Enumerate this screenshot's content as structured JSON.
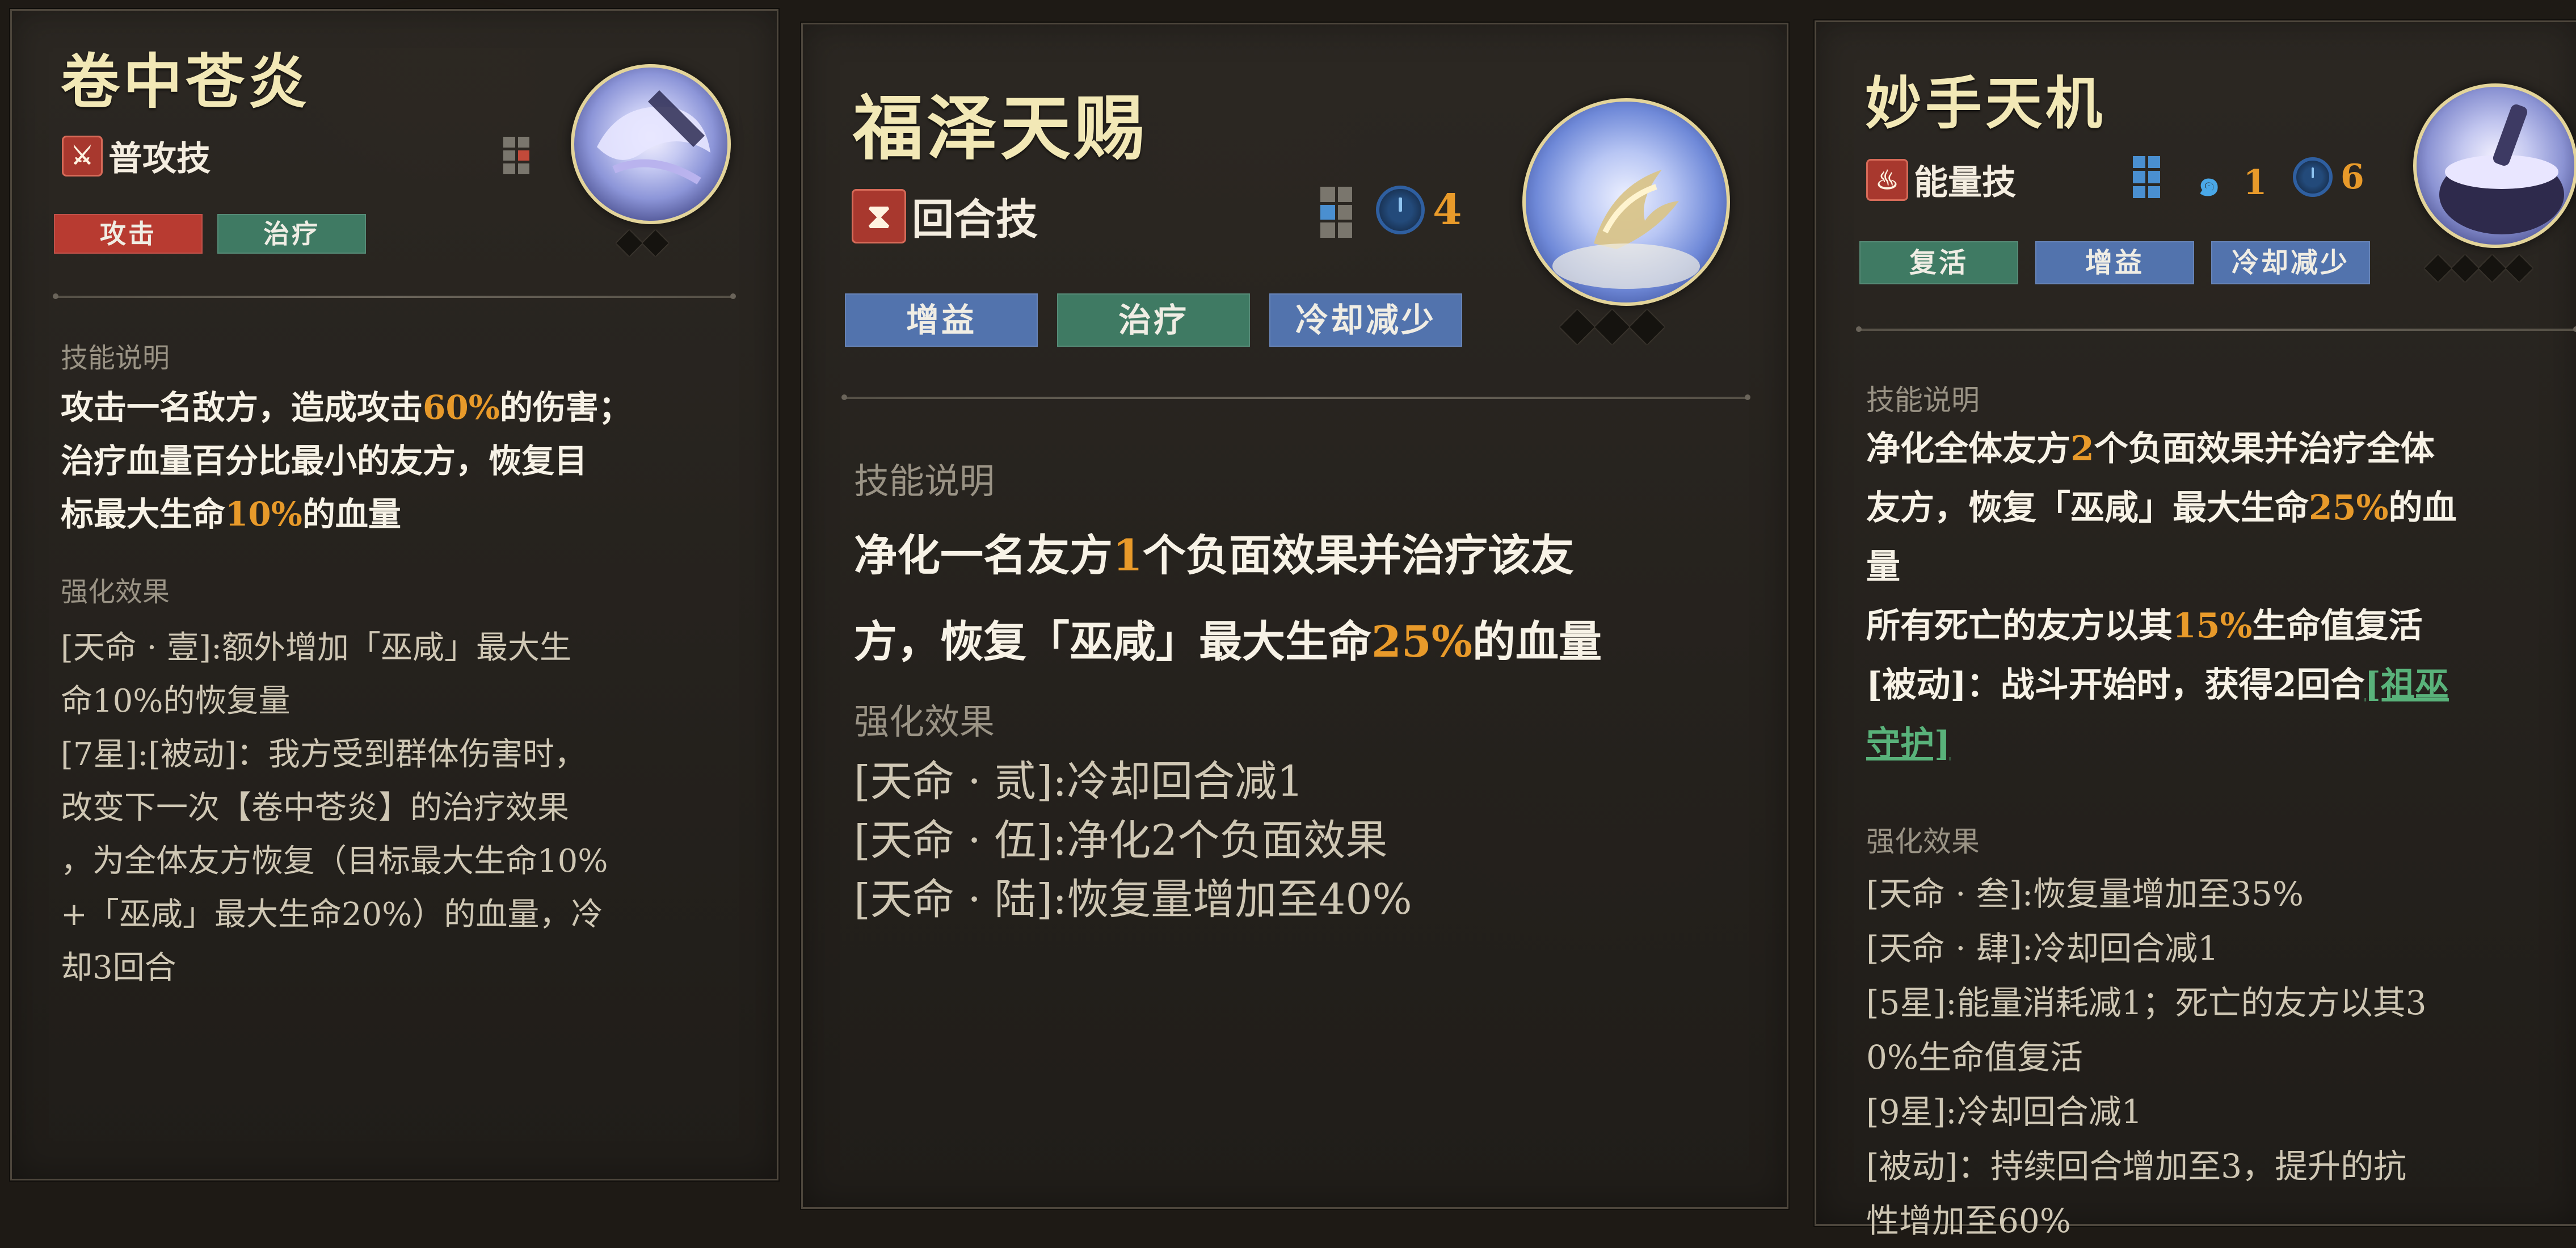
{
  "cards": [
    {
      "title": "卷中苍炎",
      "skill_type": "普攻技",
      "tags": [
        {
          "label": "攻击",
          "color": "#b83b31"
        },
        {
          "label": "治疗",
          "color": "#3f7a63"
        }
      ],
      "stars": "◆◆",
      "section_desc": "技能说明",
      "description": [
        [
          {
            "t": "攻击一名敌方，造成攻击"
          },
          {
            "t": "60%",
            "hl": true
          },
          {
            "t": "的伤害；"
          }
        ],
        [
          {
            "t": "治疗血量百分比最小的友方，恢复目"
          }
        ],
        [
          {
            "t": "标最大生命"
          },
          {
            "t": "10%",
            "hl": true
          },
          {
            "t": "的血量"
          }
        ]
      ],
      "section_effects": "强化效果",
      "effects": [
        "[天命 · 壹]:额外增加「巫咸」最大生",
        "命10%的恢复量",
        "[7星]:[被动]：我方受到群体伤害时，",
        "改变下一次【卷中苍炎】的治疗效果",
        "，为全体友方恢复（目标最大生命10%",
        "+「巫咸」最大生命20%）的血量，冷",
        "却3回合"
      ]
    },
    {
      "title": "福泽天赐",
      "skill_type": "回合技",
      "cooldown": "4",
      "tags": [
        {
          "label": "增益",
          "color": "#5273ad"
        },
        {
          "label": "治疗",
          "color": "#3f7a63"
        },
        {
          "label": "冷却减少",
          "color": "#5273ad"
        }
      ],
      "stars": "◆◆◆",
      "section_desc": "技能说明",
      "description": [
        [
          {
            "t": "净化一名友方"
          },
          {
            "t": "1",
            "hl": true
          },
          {
            "t": "个负面效果并治疗该友"
          }
        ],
        [
          {
            "t": "方，恢复「巫咸」最大生命"
          },
          {
            "t": "25%",
            "hl": true
          },
          {
            "t": "的血量"
          }
        ]
      ],
      "section_effects": "强化效果",
      "effects": [
        "[天命 · 贰]:冷却回合减1",
        "[天命 · 伍]:净化2个负面效果",
        "[天命 · 陆]:恢复量增加至40%"
      ]
    },
    {
      "title": "妙手天机",
      "skill_type": "能量技",
      "energy": "1",
      "cooldown": "6",
      "tags": [
        {
          "label": "复活",
          "color": "#3f7a63"
        },
        {
          "label": "增益",
          "color": "#5273ad"
        },
        {
          "label": "冷却减少",
          "color": "#5273ad"
        }
      ],
      "stars": "◆◆◆◆",
      "section_desc": "技能说明",
      "description": [
        [
          {
            "t": "净化全体友方"
          },
          {
            "t": "2",
            "hl": true
          },
          {
            "t": "个负面效果并治疗全体"
          }
        ],
        [
          {
            "t": "友方，恢复「巫咸」最大生命"
          },
          {
            "t": "25%",
            "hl": true
          },
          {
            "t": "的血"
          }
        ],
        [
          {
            "t": "量"
          }
        ],
        [
          {
            "t": "所有死亡的友方以其"
          },
          {
            "t": "15%",
            "hl": true
          },
          {
            "t": "生命值复活"
          }
        ],
        [
          {
            "t": "[被动]：战斗开始时，获得2回合"
          },
          {
            "t": "[祖巫",
            "lk": true
          }
        ],
        [
          {
            "t": "守护]",
            "lk": true
          }
        ]
      ],
      "section_effects": "强化效果",
      "effects": [
        "[天命 · 叁]:恢复量增加至35%",
        "[天命 · 肆]:冷却回合减1",
        "[5星]:能量消耗减1；死亡的友方以其3",
        "0%生命值复活",
        "[9星]:冷却回合减1",
        "[被动]：持续回合增加至3，提升的抗",
        "性增加至60%"
      ]
    }
  ],
  "colors": {
    "title": "#f2e8b6",
    "highlight": "#e89a2a",
    "link": "#59b27a",
    "effect_text": "#cfc7b4"
  },
  "icons": {
    "skill_type_card1": "sword-icon",
    "skill_type_card2": "hourglass-icon",
    "skill_type_card3": "flame-icon",
    "energy": "swirl-icon",
    "cooldown": "clock-icon"
  }
}
